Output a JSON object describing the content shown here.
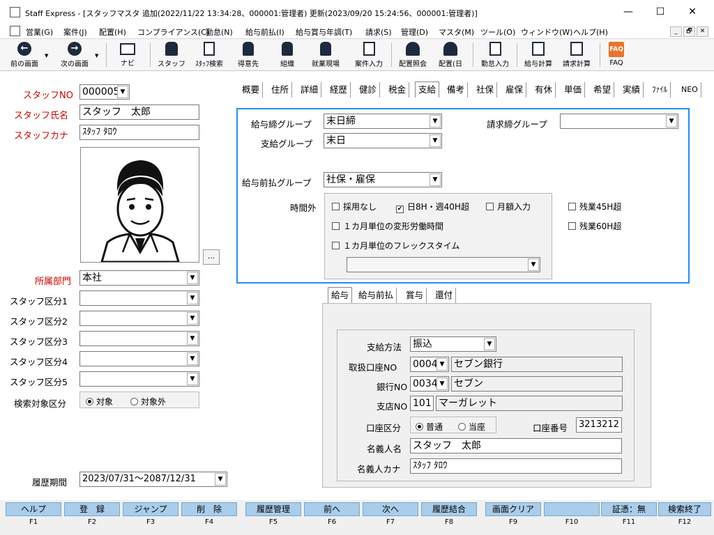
{
  "window": {
    "title": "Staff Express - [スタッフマスタ 追加(2022/11/22 13:34:28、000001:管理者) 更新(2023/09/20 15:24:56、000001:管理者)]",
    "min": "—",
    "max": "☐",
    "close": "✕"
  },
  "menu": [
    "営業(G)",
    "案件(J)",
    "配置(H)",
    "コンプライアンス(C)",
    "勤怠(N)",
    "給与前払(I)",
    "給与賞与年調(T)",
    "請求(S)",
    "管理(D)",
    "マスタ(M)",
    "ツール(O)",
    "ウィンドウ(W)",
    "ヘルプ(H)"
  ],
  "mdi": {
    "min": "_",
    "restore": "🗗",
    "close": "✕"
  },
  "toolbar": [
    {
      "label": "前の画面",
      "icon": "arrow-left-icon"
    },
    {
      "label": "次の画面",
      "icon": "arrow-right-icon"
    },
    {
      "label": "ナビ",
      "icon": "keyboard-icon"
    },
    {
      "label": "スタッフ",
      "icon": "staff-icon"
    },
    {
      "label": "ｽﾀｯﾌ検索",
      "icon": "staff-search-icon"
    },
    {
      "label": "得意先",
      "icon": "client-icon"
    },
    {
      "label": "組織",
      "icon": "organization-icon"
    },
    {
      "label": "就業現場",
      "icon": "worksite-icon"
    },
    {
      "label": "案件入力",
      "icon": "job-entry-icon"
    },
    {
      "label": "配置照会",
      "icon": "placement-inquiry-icon"
    },
    {
      "label": "配置(日",
      "icon": "placement-day-icon"
    },
    {
      "label": "勤怠入力",
      "icon": "attendance-icon"
    },
    {
      "label": "給与計算",
      "icon": "payroll-icon"
    },
    {
      "label": "請求計算",
      "icon": "billing-icon"
    },
    {
      "label": "FAQ",
      "icon": "faq-icon"
    }
  ],
  "left": {
    "staff_no_label": "スタッフNO",
    "staff_no": "000005",
    "staff_name_label": "スタッフ氏名",
    "staff_name": "スタッフ　太郎",
    "staff_kana_label": "スタッフカナ",
    "staff_kana": "ｽﾀｯﾌ ﾀﾛｳ",
    "photo_button": "...",
    "dept_label": "所属部門",
    "dept": "本社",
    "kubun": [
      {
        "label": "スタッフ区分1",
        "value": ""
      },
      {
        "label": "スタッフ区分2",
        "value": ""
      },
      {
        "label": "スタッフ区分3",
        "value": ""
      },
      {
        "label": "スタッフ区分4",
        "value": ""
      },
      {
        "label": "スタッフ区分5",
        "value": ""
      }
    ],
    "search_label": "検索対象区分",
    "search_on": "対象",
    "search_off": "対象外",
    "period_label": "履歴期間",
    "period": "2023/07/31～2087/12/31"
  },
  "tabs": [
    "概要",
    "住所",
    "詳細",
    "経歴",
    "健診",
    "税金",
    "支給",
    "備考",
    "社保",
    "雇保",
    "有休",
    "単価",
    "希望",
    "実績",
    "ﾌｧｲﾙ",
    "NEO"
  ],
  "active_tab": "支給",
  "pay": {
    "close_group_label": "給与締グループ",
    "close_group": "末日締",
    "bill_group_label": "請求締グループ",
    "bill_group": "",
    "pay_group_label": "支給グループ",
    "pay_group": "末日",
    "advance_group_label": "給与前払グループ",
    "advance_group": "社保・雇保",
    "overtime_label": "時間外",
    "ot_items": [
      {
        "label": "採用なし",
        "checked": false
      },
      {
        "label": "日8H・週40H超",
        "checked": true
      },
      {
        "label": "月額入力",
        "checked": false
      },
      {
        "label": "１カ月単位の変形労働時間",
        "checked": false
      },
      {
        "label": "１カ月単位のフレックスタイム",
        "checked": false
      }
    ],
    "ot45": "残業45H超",
    "ot60": "残業60H超",
    "flex_select": ""
  },
  "subtabs": [
    "給与",
    "給与前払",
    "賞与",
    "還付"
  ],
  "bank": {
    "method_label": "支給方法",
    "method": "振込",
    "branch_office_label": "取扱口座NO",
    "branch_office_no": "0004",
    "branch_office_name": "セブン銀行",
    "bank_label": "銀行NO",
    "bank_no": "0034",
    "bank_name": "セブン",
    "shop_label": "支店NO",
    "shop_no": "101",
    "shop_name": "マーガレット",
    "acct_type_label": "口座区分",
    "acct_type_normal": "普通",
    "acct_type_current": "当座",
    "acct_no_label": "口座番号",
    "acct_no": "3213212",
    "holder_label": "名義人名",
    "holder": "スタッフ　太郎",
    "holder_kana_label": "名義人カナ",
    "holder_kana": "ｽﾀｯﾌ ﾀﾛｳ"
  },
  "fkeys": [
    {
      "label": "ヘルプ",
      "key": "F1"
    },
    {
      "label": "登　録",
      "key": "F2"
    },
    {
      "label": "ジャンプ",
      "key": "F3"
    },
    {
      "label": "削　除",
      "key": "F4"
    },
    {
      "label": "履歴管理",
      "key": "F5"
    },
    {
      "label": "前へ",
      "key": "F6"
    },
    {
      "label": "次へ",
      "key": "F7"
    },
    {
      "label": "履歴結合",
      "key": "F8"
    },
    {
      "label": "画面クリア",
      "key": "F9"
    },
    {
      "label": "",
      "key": "F10"
    },
    {
      "label": "証憑：無",
      "key": "F11"
    },
    {
      "label": "検索終了",
      "key": "F12"
    }
  ]
}
